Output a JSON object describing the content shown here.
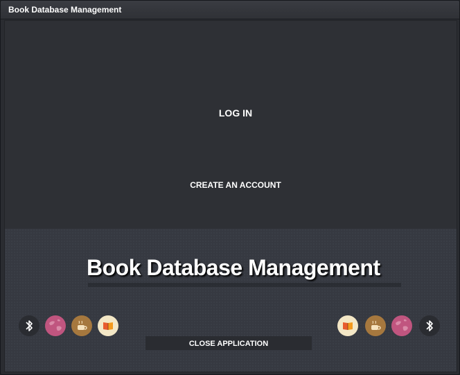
{
  "window": {
    "title": "Book Database Management"
  },
  "auth": {
    "login_label": "LOG IN",
    "create_account_label": "CREATE AN ACCOUNT"
  },
  "banner": {
    "title": "Book Database Management"
  },
  "footer": {
    "close_label": "CLOSE APPLICATION",
    "left_icons": [
      "bluetooth-icon",
      "globe-icon",
      "coffee-cup-icon",
      "book-icon"
    ],
    "right_icons": [
      "book-icon",
      "coffee-cup-icon",
      "globe-icon",
      "bluetooth-icon"
    ]
  },
  "colors": {
    "background": "#2e3035",
    "bottom_panel": "#363941",
    "text": "#ffffff",
    "globe": "#c0557f",
    "cup": "#a6783e",
    "book_bg": "#f3e7c6"
  }
}
